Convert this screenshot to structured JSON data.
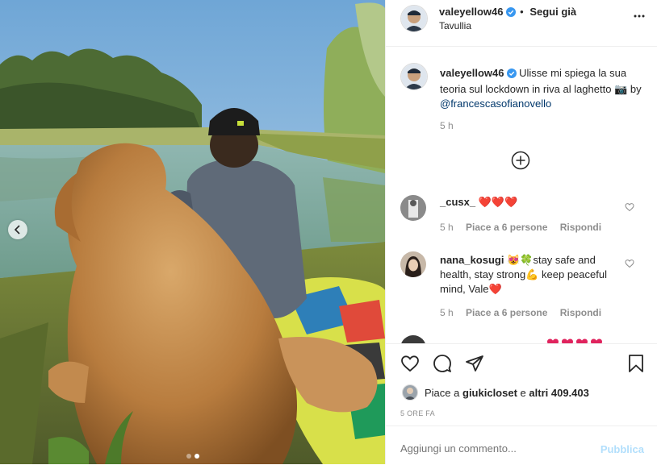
{
  "post": {
    "username": "valeyellow46",
    "follow_separator": "•",
    "follow_label": "Segui già",
    "location": "Tavullia"
  },
  "caption": {
    "username": "valeyellow46",
    "text": "Ulisse mi spiega la sua teoria sul lockdown in riva al laghetto",
    "camera_emoji": "📷",
    "by": "by",
    "mention": "@francescasofianovello",
    "time": "5 h"
  },
  "comments": [
    {
      "username": "_cusx_",
      "text": "❤️❤️❤️",
      "time": "5 h",
      "likes": "Piace a 6 persone",
      "reply": "Rispondi"
    },
    {
      "username": "nana_kosugi",
      "text": "😻🍀stay safe and health, stay strong💪 keep peaceful mind, Vale❤️",
      "time": "5 h",
      "likes": "Piace a 6 persone",
      "reply": "Rispondi"
    }
  ],
  "likes": {
    "prefix": "Piace a",
    "user": "giukicloset",
    "joiner": "e",
    "others": "altri 409.403"
  },
  "timestamp": "5 ORE FA",
  "add_comment": {
    "placeholder": "Aggiungi un commento...",
    "publish": "Pubblica"
  },
  "carousel": {
    "slides": 2,
    "current": 2
  },
  "colors": {
    "text": "#262626",
    "secondary": "#8e8e8e",
    "link": "#00376b",
    "verified": "#3897f0",
    "publish_disabled": "#b2dffc",
    "border": "#efefef"
  }
}
